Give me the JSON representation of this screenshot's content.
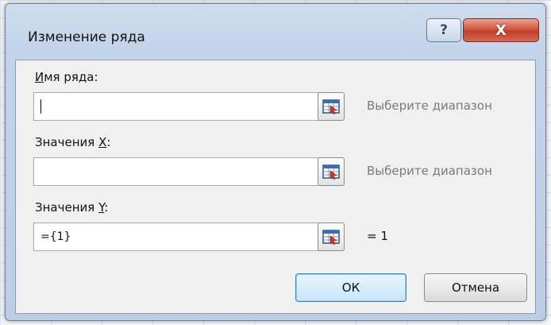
{
  "window": {
    "title": "Изменение ряда",
    "help_glyph": "?",
    "close_glyph": "X"
  },
  "fields": [
    {
      "label_prefix": "",
      "label_mnemonic": "И",
      "label_suffix": "мя ряда:",
      "value": "",
      "hint": "Выберите диапазон",
      "focused": true
    },
    {
      "label_prefix": "Значения ",
      "label_mnemonic": "X",
      "label_suffix": ":",
      "value": "",
      "hint": "Выберите диапазон",
      "focused": false
    },
    {
      "label_prefix": "Значения ",
      "label_mnemonic": "Y",
      "label_suffix": ":",
      "value": "={1}",
      "hint": "= 1",
      "focused": false
    }
  ],
  "buttons": {
    "ok": "ОК",
    "cancel": "Отмена"
  },
  "icons": {
    "range_select": "range-select-icon",
    "help": "help-icon",
    "close": "close-icon"
  },
  "colors": {
    "close_button": "#c1402a",
    "ok_border": "#3c7fb1",
    "hint_text": "#7a7a7a"
  }
}
